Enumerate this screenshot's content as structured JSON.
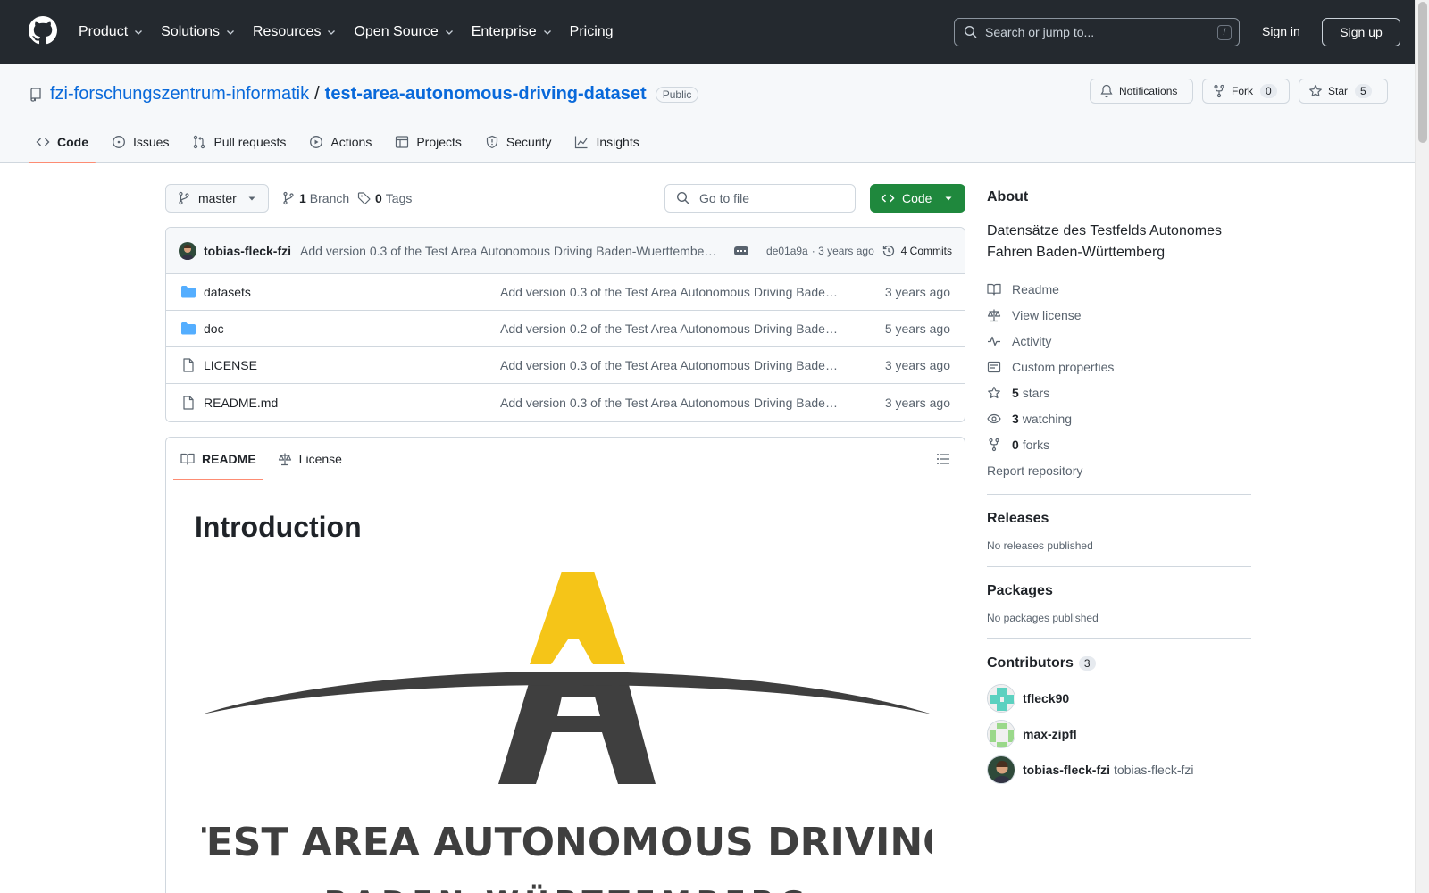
{
  "header": {
    "nav": [
      "Product",
      "Solutions",
      "Resources",
      "Open Source",
      "Enterprise",
      "Pricing"
    ],
    "search_placeholder": "Search or jump to...",
    "search_shortcut": "/",
    "sign_in": "Sign in",
    "sign_up": "Sign up"
  },
  "repo": {
    "owner": "fzi-forschungszentrum-informatik",
    "separator": "/",
    "name": "test-area-autonomous-driving-dataset",
    "visibility": "Public",
    "notifications_label": "Notifications",
    "fork_label": "Fork",
    "fork_count": "0",
    "star_label": "Star",
    "star_count": "5"
  },
  "tabs": [
    "Code",
    "Issues",
    "Pull requests",
    "Actions",
    "Projects",
    "Security",
    "Insights"
  ],
  "toolbar": {
    "branch": "master",
    "branch_count": "1",
    "branch_label": "Branch",
    "tag_count": "0",
    "tag_label": "Tags",
    "go_to_file": "Go to file",
    "code_button": "Code"
  },
  "commit": {
    "author": "tobias-fleck-fzi",
    "message": "Add version 0.3 of the Test Area Autonomous Driving Baden-Wuerttembe…",
    "hash": "de01a9a",
    "age": "· 3 years ago",
    "commits_label": "4 Commits"
  },
  "files": [
    {
      "type": "folder",
      "name": "datasets",
      "message": "Add version 0.3 of the Test Area Autonomous Driving Bade…",
      "age": "3 years ago"
    },
    {
      "type": "folder",
      "name": "doc",
      "message": "Add version 0.2 of the Test Area Autonomous Driving Bade…",
      "age": "5 years ago"
    },
    {
      "type": "file",
      "name": "LICENSE",
      "message": "Add version 0.3 of the Test Area Autonomous Driving Bade…",
      "age": "3 years ago"
    },
    {
      "type": "file",
      "name": "README.md",
      "message": "Add version 0.3 of the Test Area Autonomous Driving Bade…",
      "age": "3 years ago"
    }
  ],
  "readme": {
    "tab_readme": "README",
    "tab_license": "License",
    "heading": "Introduction",
    "logo_text": "TEST AREA AUTONOMOUS DRIVING",
    "logo_subtext": "BADEN-WÜRTTEMBERG"
  },
  "about": {
    "title": "About",
    "description": "Datensätze des Testfelds Autonomes Fahren Baden-Württemberg",
    "readme": "Readme",
    "license": "View license",
    "activity": "Activity",
    "custom_properties": "Custom properties",
    "stars_count": "5",
    "stars_label": "stars",
    "watching_count": "3",
    "watching_label": "watching",
    "forks_count": "0",
    "forks_label": "forks",
    "report": "Report repository"
  },
  "releases": {
    "title": "Releases",
    "empty": "No releases published"
  },
  "packages": {
    "title": "Packages",
    "empty": "No packages published"
  },
  "contributors": {
    "title": "Contributors",
    "count": "3",
    "list": [
      {
        "login": "tfleck90",
        "name": ""
      },
      {
        "login": "max-zipfl",
        "name": ""
      },
      {
        "login": "tobias-fleck-fzi",
        "name": "tobias-fleck-fzi"
      }
    ]
  },
  "colors": {
    "link": "#0969da",
    "code_button": "#1f883d",
    "header_bg": "#24292f",
    "tab_underline": "#fd8c73",
    "logo_yellow": "#f5c518",
    "logo_gray": "#3f3f3f"
  }
}
